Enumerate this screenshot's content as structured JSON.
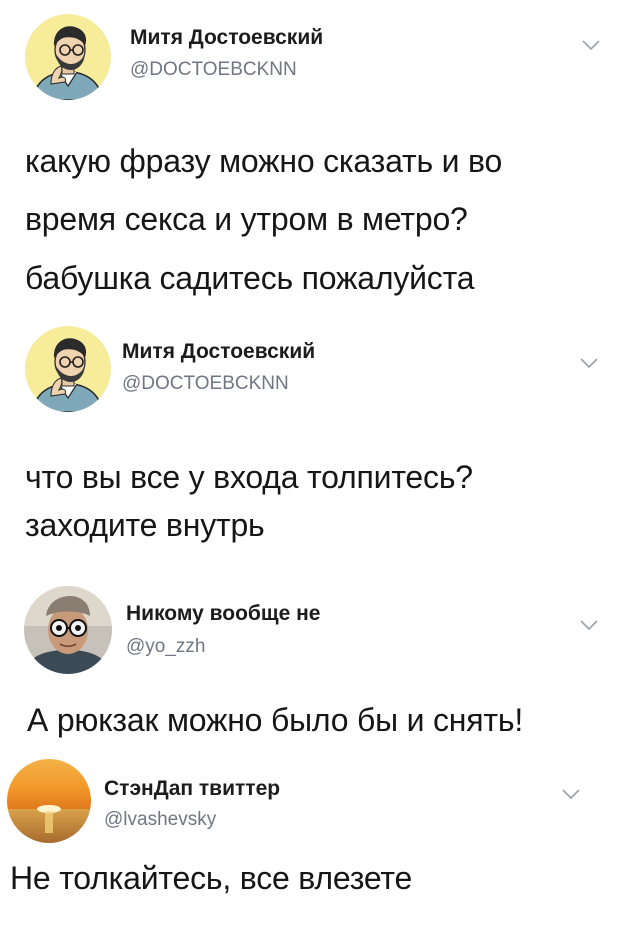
{
  "tweets": [
    {
      "author": "Митя Достоевский",
      "handle": "@DOCTOEBCKNN",
      "lines": [
        "какую фразу можно сказать и во",
        "время секса и утром в метро?",
        "бабушка садитесь пожалуйста"
      ],
      "avatar_icon": "illustrated-man-avatar",
      "menu_icon": "chevron-down-icon"
    },
    {
      "author": "Митя Достоевский",
      "handle": "@DOCTOEBCKNN",
      "lines": [
        "что вы все у входа толпитесь?",
        "заходите внутрь"
      ],
      "avatar_icon": "illustrated-man-avatar",
      "menu_icon": "chevron-down-icon"
    },
    {
      "author": "Никому вообще не",
      "handle": "@yo_zzh",
      "lines": [
        "А рюкзак можно было бы и снять!"
      ],
      "avatar_icon": "man-with-glasses-avatar",
      "menu_icon": "chevron-down-icon"
    },
    {
      "author": "СтэнДап твиттер",
      "handle": "@lvashevsky",
      "lines": [
        "Не толкайтесь, все влезете"
      ],
      "avatar_icon": "sunset-avatar",
      "menu_icon": "chevron-down-icon"
    }
  ],
  "colors": {
    "background": "#ffffff",
    "text": "#161616",
    "handle": "#6e7782",
    "avatar_yellow": "#f6ec9a",
    "sunset_orange": "#f39a2a"
  }
}
